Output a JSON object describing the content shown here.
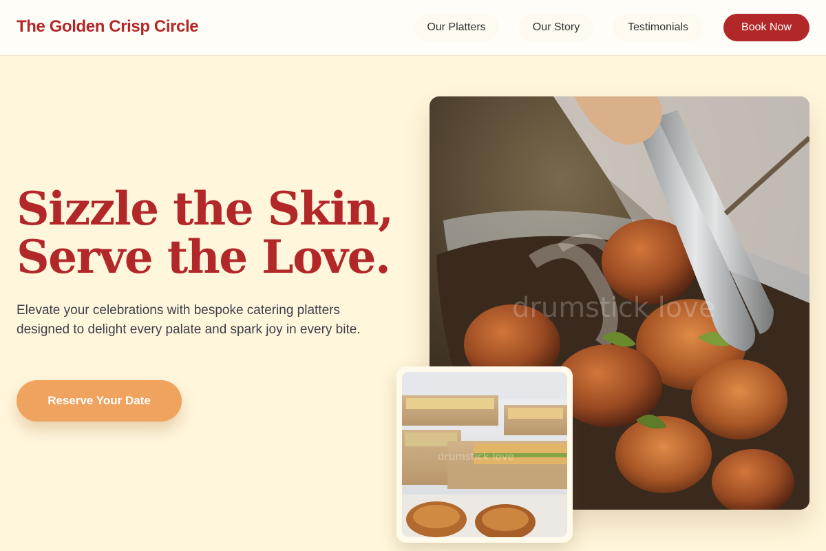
{
  "brand": {
    "name": "The Golden Crisp Circle"
  },
  "nav": {
    "items": [
      {
        "label": "Our Platters"
      },
      {
        "label": "Our Story"
      },
      {
        "label": "Testimonials"
      }
    ],
    "cta_label": "Book Now"
  },
  "hero": {
    "title_line1": "Sizzle the Skin,",
    "title_line2": "Serve the Love.",
    "description": "Elevate your celebrations with bespoke catering platters designed to delight every palate and spark joy in every bite.",
    "cta_label": "Reserve Your Date"
  },
  "images": {
    "main_alt": "Grilled chicken drumsticks lifted with tongs from a tray",
    "inset_alt": "Catering boxes filled with sandwiches and pastries",
    "watermark": "drumstick love"
  },
  "colors": {
    "brand": "#b22727",
    "cta": "#f0a35e",
    "background": "#fff6dc"
  }
}
